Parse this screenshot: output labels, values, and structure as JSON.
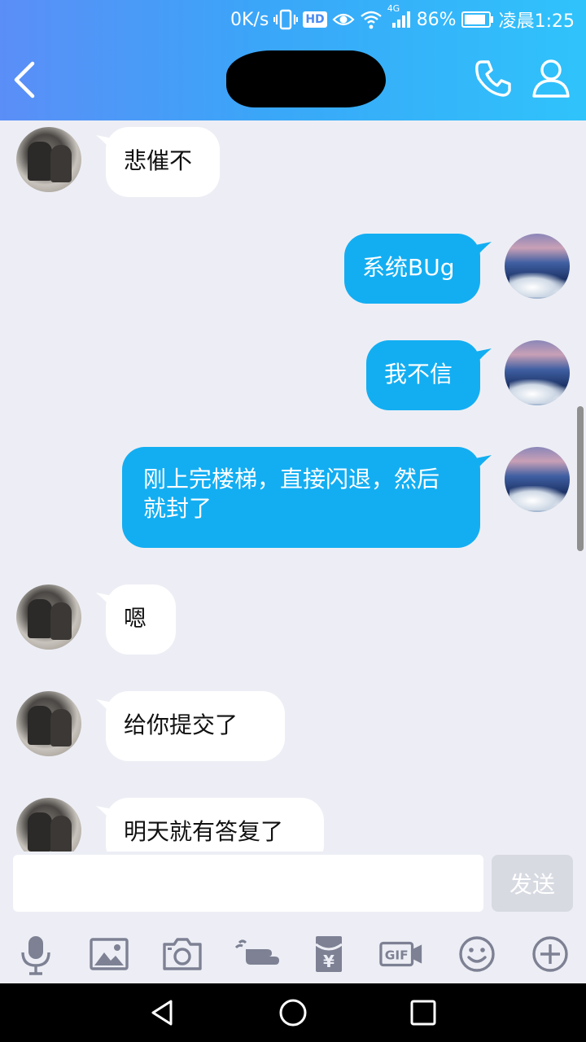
{
  "status_bar": {
    "network_speed": "0K/s",
    "hd_badge": "HD",
    "network_type": "4G",
    "battery": "86%",
    "time": "凌晨1:25",
    "icons": [
      "vibrate-icon",
      "hd-icon",
      "eye-icon",
      "wifi-icon",
      "signal-icon",
      "battery-icon"
    ]
  },
  "header": {
    "contact_name": "",
    "contact_name_redacted": true,
    "icons": [
      "back-arrow-icon",
      "phone-icon",
      "profile-icon"
    ]
  },
  "messages": [
    {
      "side": "in",
      "text": "悲催不"
    },
    {
      "side": "out",
      "text": "系统BUg"
    },
    {
      "side": "out",
      "text": "我不信"
    },
    {
      "side": "out",
      "text": "刚上完楼梯，直接闪退，然后就封了"
    },
    {
      "side": "in",
      "text": "嗯"
    },
    {
      "side": "in",
      "text": "给你提交了"
    },
    {
      "side": "in",
      "text": "明天就有答复了"
    }
  ],
  "composer": {
    "input_value": "",
    "send_label": "发送"
  },
  "toolbar": {
    "gif_label": "GIF",
    "redpacket_symbol": "¥",
    "icons": [
      "microphone-icon",
      "image-icon",
      "camera-icon",
      "poke-icon",
      "red-packet-icon",
      "gif-icon",
      "emoji-icon",
      "plus-icon"
    ]
  },
  "colors": {
    "header_gradient_start": "#5b8ef7",
    "header_gradient_end": "#2fc3fb",
    "outgoing_bubble": "#13aef2",
    "incoming_bubble": "#ffffff",
    "chat_background": "#edeef5",
    "icon_gray": "#7d8193"
  }
}
